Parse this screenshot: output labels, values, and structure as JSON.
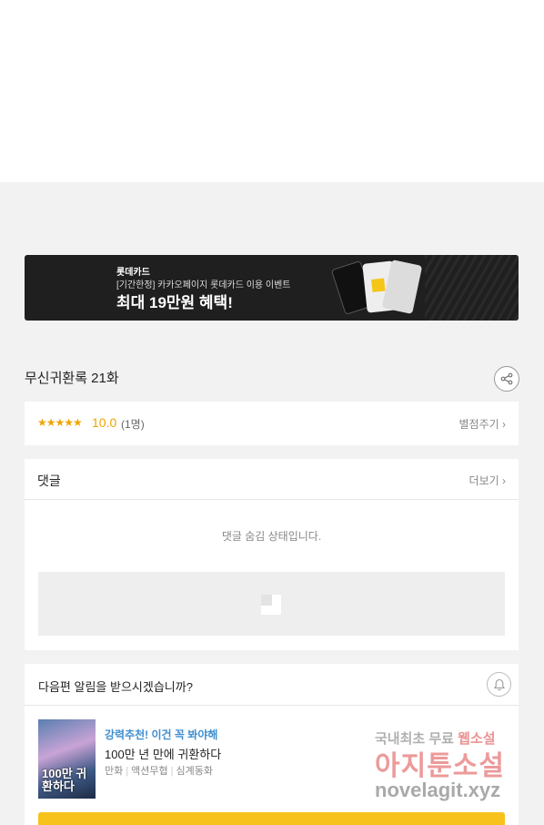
{
  "banner": {
    "brand": "롯데카드",
    "subtitle": "[기간한정] 카카오페이지 롯데카드 이용 이벤트",
    "headline": "최대 19만원 혜택!"
  },
  "episode": {
    "title": "무신귀환록 21화"
  },
  "rating": {
    "stars": "★★★★★",
    "score": "10.0",
    "count": "(1명)",
    "rate_link": "별점주기 ›"
  },
  "comments": {
    "title": "댓글",
    "more_link": "더보기 ›",
    "hidden_message": "댓글 숨김 상태입니다."
  },
  "next_notice": {
    "question": "다음편 알림을 받으시겠습니까?",
    "promo": "강력추천! 이건 꼭 봐야해",
    "work_title": "100만 년 만에 귀환하다",
    "tags": [
      "만화",
      "액션무협",
      "심계동화"
    ],
    "cover_text": "100만 귀환하다"
  },
  "watermark": {
    "line1_prefix": "국내최초 무료 ",
    "line1_accent": "웹소설",
    "line2": "아지툰소설",
    "line3": "novelagit.xyz"
  },
  "colors": {
    "accent": "#f0a500",
    "promo_blue": "#3e8ed0",
    "button_yellow": "#f7c21c"
  }
}
